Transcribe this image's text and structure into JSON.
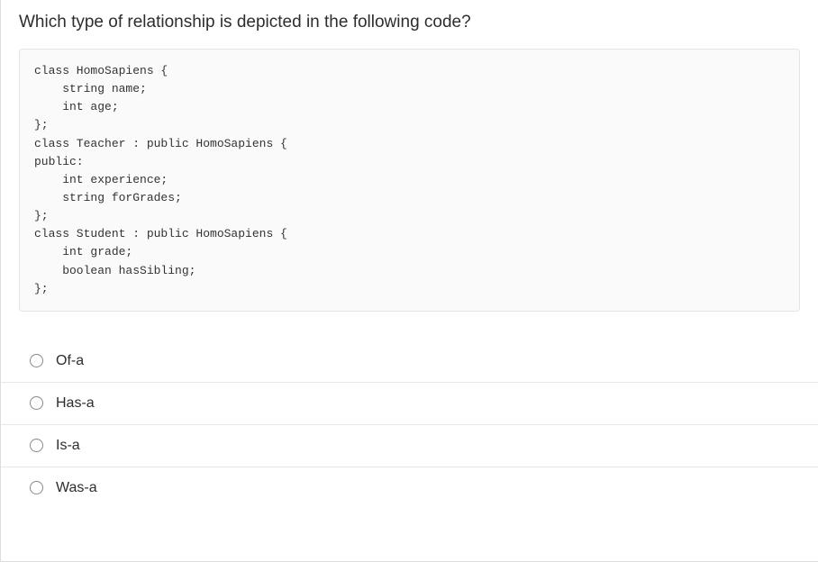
{
  "question": {
    "title": "Which type of relationship is depicted in the following code?",
    "code": "class HomoSapiens {\n    string name;\n    int age;\n};\nclass Teacher : public HomoSapiens {\npublic:\n    int experience;\n    string forGrades;\n};\nclass Student : public HomoSapiens {\n    int grade;\n    boolean hasSibling;\n};"
  },
  "options": [
    {
      "label": "Of-a"
    },
    {
      "label": "Has-a"
    },
    {
      "label": "Is-a"
    },
    {
      "label": "Was-a"
    }
  ]
}
